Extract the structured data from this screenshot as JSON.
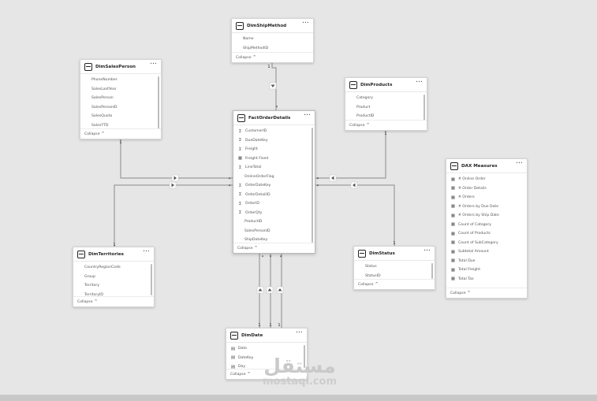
{
  "diagram": {
    "tables": [
      {
        "id": "ship",
        "title": "DimShipMethod",
        "fields": [
          {
            "label": "Name",
            "icon": ""
          },
          {
            "label": "ShipMethodID",
            "icon": ""
          }
        ],
        "footer": "Collapse"
      },
      {
        "id": "sales",
        "title": "DimSalesPerson",
        "fields": [
          {
            "label": "PhoneNumber",
            "icon": ""
          },
          {
            "label": "SalesLastYear",
            "icon": ""
          },
          {
            "label": "SalesPerson",
            "icon": ""
          },
          {
            "label": "SalesPersonID",
            "icon": ""
          },
          {
            "label": "SalesQuota",
            "icon": ""
          },
          {
            "label": "SalesYTD",
            "icon": ""
          }
        ],
        "footer": "Collapse"
      },
      {
        "id": "prod",
        "title": "DimProducts",
        "fields": [
          {
            "label": "Category",
            "icon": ""
          },
          {
            "label": "Product",
            "icon": ""
          },
          {
            "label": "ProductID",
            "icon": ""
          }
        ],
        "footer": "Collapse"
      },
      {
        "id": "fact",
        "title": "FactOrderDetails",
        "fields": [
          {
            "label": "CustomerID",
            "icon": "sigma"
          },
          {
            "label": "DueDateKey",
            "icon": "sigma"
          },
          {
            "label": "Freight",
            "icon": "sigma"
          },
          {
            "label": "Freight Fixed",
            "icon": "calc"
          },
          {
            "label": "LineTotal",
            "icon": "sigma"
          },
          {
            "label": "OnlineOrderFlag",
            "icon": ""
          },
          {
            "label": "OrderDateKey",
            "icon": "sigma"
          },
          {
            "label": "OrderDetailID",
            "icon": "sigma"
          },
          {
            "label": "OrderID",
            "icon": "sigma"
          },
          {
            "label": "OrderQty",
            "icon": "sigma"
          },
          {
            "label": "ProductID",
            "icon": ""
          },
          {
            "label": "SalesPersonID",
            "icon": ""
          },
          {
            "label": "ShipDateKey",
            "icon": ""
          }
        ],
        "footer": "Collapse"
      },
      {
        "id": "dax",
        "title": "DAX Measures",
        "fields": [
          {
            "label": "# Online Order",
            "icon": "calc"
          },
          {
            "label": "# Order Details",
            "icon": "calc"
          },
          {
            "label": "# Orders",
            "icon": "calc"
          },
          {
            "label": "# Orders by Due Date",
            "icon": "calc"
          },
          {
            "label": "# Orders by Ship Date",
            "icon": "calc"
          },
          {
            "label": "Count of Category",
            "icon": "calc"
          },
          {
            "label": "Count of Products",
            "icon": "calc"
          },
          {
            "label": "Count of SubCategory",
            "icon": "calc"
          },
          {
            "label": "Subtotal Amount",
            "icon": "calc"
          },
          {
            "label": "Total Due",
            "icon": "calc"
          },
          {
            "label": "Total Freight",
            "icon": "calc"
          },
          {
            "label": "Total Tax",
            "icon": "calc"
          }
        ],
        "footer": "Collapse"
      },
      {
        "id": "terr",
        "title": "DimTerritories",
        "fields": [
          {
            "label": "CountryRegionCode",
            "icon": ""
          },
          {
            "label": "Group",
            "icon": ""
          },
          {
            "label": "Territory",
            "icon": ""
          },
          {
            "label": "TerritoryID",
            "icon": ""
          }
        ],
        "footer": "Collapse"
      },
      {
        "id": "status",
        "title": "DimStatus",
        "fields": [
          {
            "label": "Status",
            "icon": ""
          },
          {
            "label": "StatusID",
            "icon": ""
          }
        ],
        "footer": "Collapse"
      },
      {
        "id": "date",
        "title": "DimDate",
        "fields": [
          {
            "label": "Date",
            "icon": "cal"
          },
          {
            "label": "DateKey",
            "icon": "cal"
          },
          {
            "label": "Day",
            "icon": "cal"
          }
        ],
        "footer": "Collapse"
      }
    ],
    "relationships": [
      {
        "from": "ship",
        "to": "fact",
        "one": "1",
        "many": "*"
      },
      {
        "from": "sales",
        "to": "fact",
        "one": "1",
        "many": "*"
      },
      {
        "from": "terr",
        "to": "fact",
        "one": "1",
        "many": "*"
      },
      {
        "from": "prod",
        "to": "fact",
        "one": "1",
        "many": "*"
      },
      {
        "from": "status",
        "to": "fact",
        "one": "1",
        "many": "*"
      },
      {
        "from": "date",
        "to": "fact",
        "one": "1",
        "many": "*"
      },
      {
        "from": "date",
        "to": "fact",
        "one": "1",
        "many": "*"
      },
      {
        "from": "date",
        "to": "fact",
        "one": "1",
        "many": "*"
      }
    ]
  },
  "icons": {
    "table": "table-icon",
    "more": "more-options-icon",
    "collapse": "chevron-up-icon",
    "sigma": "sigma-icon",
    "calc": "calculator-icon",
    "cal": "calendar-icon"
  },
  "colors": {
    "canvas": "#e6e6e6",
    "card": "#ffffff",
    "line": "#8a8a8a"
  },
  "watermark": {
    "arabic": "مستقل",
    "latin": "mostaql.com"
  }
}
